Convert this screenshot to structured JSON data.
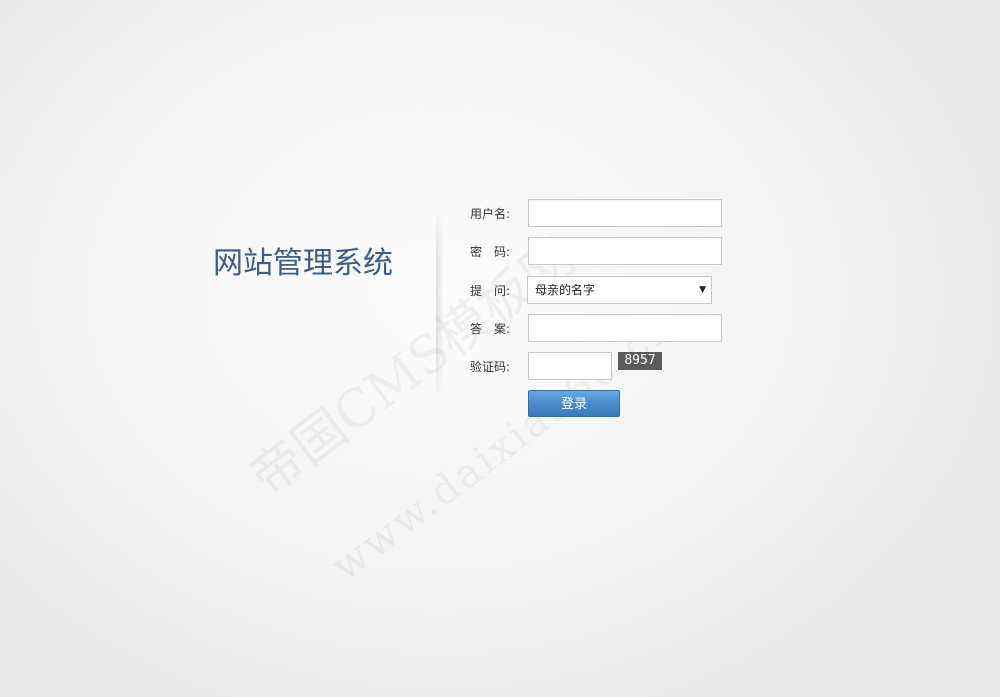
{
  "system_title": "网站管理系统",
  "form": {
    "username": {
      "label": "用户名:",
      "value": ""
    },
    "password": {
      "label": "密　码:",
      "value": ""
    },
    "question": {
      "label": "提　问:",
      "selected": "母亲的名字"
    },
    "answer": {
      "label": "答　案:",
      "value": ""
    },
    "captcha": {
      "label": "验证码:",
      "value": "",
      "code": "8957"
    }
  },
  "login_button_label": "登录",
  "watermark": {
    "line1": "帝国CMS模板网",
    "line2": "www.daixia360.cn"
  },
  "colors": {
    "title": "#3d5f83",
    "button": "#4a8ccc"
  }
}
